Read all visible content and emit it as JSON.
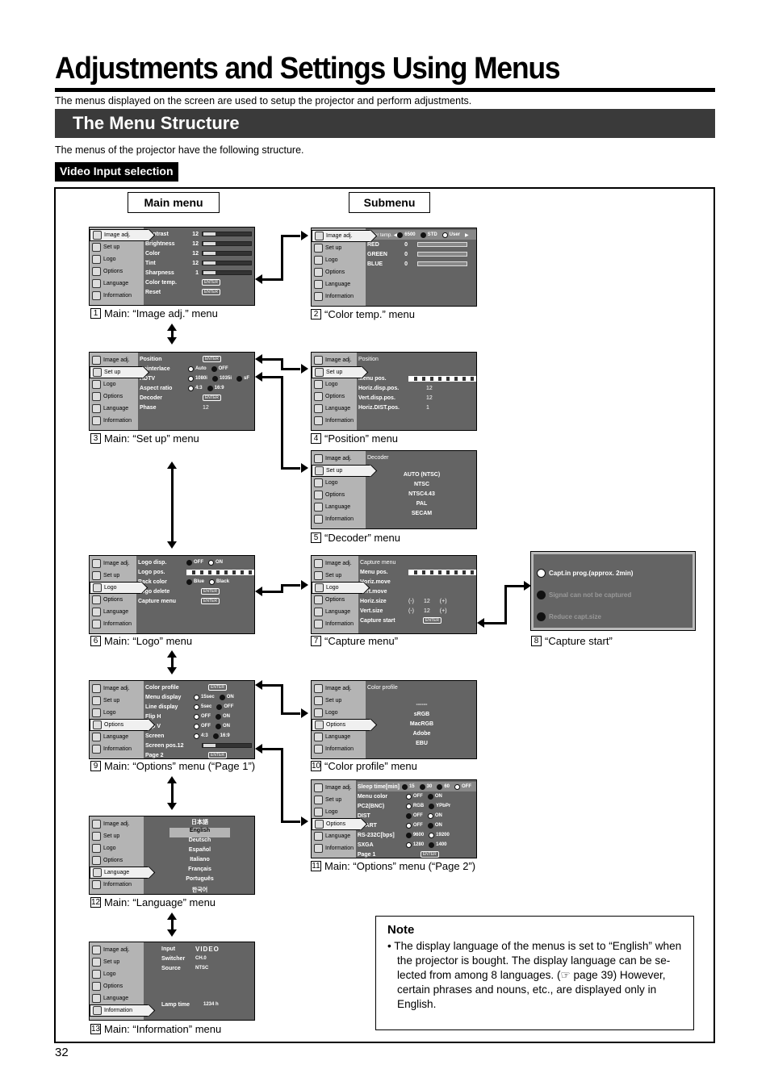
{
  "page": {
    "title": "Adjustments and Settings Using Menus",
    "intro": "The menus displayed on the screen are used to setup the projector and perform adjustments.",
    "section_title": "The Menu Structure",
    "section_intro": "The menus of the projector have the following structure.",
    "input_label": "Video Input selection",
    "main_menu_header": "Main menu",
    "submenu_header": "Submenu",
    "page_number": "32"
  },
  "sidebar": [
    "Image adj.",
    "Set up",
    "Logo",
    "Options",
    "Language",
    "Information"
  ],
  "enter": "ENTER",
  "menus": {
    "m1": {
      "num": "1",
      "caption": "Main: “Image adj.” menu",
      "rows": [
        {
          "label": "Contrast",
          "value": "12",
          "level": 0.25
        },
        {
          "label": "Brightness",
          "value": "12",
          "level": 0.25
        },
        {
          "label": "Color",
          "value": "12",
          "level": 0.25
        },
        {
          "label": "Tint",
          "value": "12",
          "level": 0.25
        },
        {
          "label": "Sharpness",
          "value": "1",
          "level": 0.25
        }
      ],
      "enter_rows": [
        "Color temp.",
        "Reset"
      ]
    },
    "m2": {
      "num": "2",
      "caption": "“Color temp.” menu",
      "header": "Color temp.",
      "options": [
        "6500",
        "STD",
        "User"
      ],
      "rows": [
        {
          "label": "RED",
          "value": "0"
        },
        {
          "label": "GREEN",
          "value": "0"
        },
        {
          "label": "BLUE",
          "value": "0"
        }
      ]
    },
    "m3": {
      "num": "3",
      "caption": "Main: “Set up” menu",
      "rows": [
        {
          "label": "Position",
          "enter": true
        },
        {
          "label": "Deinterlace",
          "opts": [
            "Auto",
            "OFF"
          ],
          "sel": 0
        },
        {
          "label": "HDTV",
          "opts": [
            "1080i",
            "1035i",
            "sF"
          ],
          "sel": 0
        },
        {
          "label": "Aspect ratio",
          "opts": [
            "4:3",
            "16:9"
          ],
          "sel": 0
        },
        {
          "label": "Decoder",
          "enter": true
        },
        {
          "label": "Phase",
          "text": "12"
        }
      ]
    },
    "m4": {
      "num": "4",
      "caption": "“Position” menu",
      "header": "Position",
      "rows": [
        {
          "label": "Menu pos."
        },
        {
          "label": "Horiz.disp.pos.",
          "value": "12"
        },
        {
          "label": "Vert.disp.pos.",
          "value": "12"
        },
        {
          "label": "Horiz.DIST.pos.",
          "value": "1"
        }
      ]
    },
    "m5": {
      "num": "5",
      "caption": "“Decoder” menu",
      "header": "Decoder",
      "items": [
        "AUTO      (NTSC)",
        "NTSC",
        "NTSC4.43",
        "PAL",
        "SECAM"
      ]
    },
    "m6": {
      "num": "6",
      "caption": "Main: “Logo” menu",
      "rows": [
        {
          "label": "Logo disp.",
          "opts": [
            "OFF",
            "ON"
          ],
          "sel": 1
        },
        {
          "label": "Logo pos."
        },
        {
          "label": "Back color",
          "opts": [
            "Blue",
            "Black"
          ],
          "sel": 1
        },
        {
          "label": "Logo delete",
          "enter": true
        },
        {
          "label": "Capture menu",
          "enter": true
        }
      ]
    },
    "m7": {
      "num": "7",
      "caption": "“Capture menu”",
      "header": "Capture menu",
      "rows": [
        {
          "label": "Menu pos."
        },
        {
          "label": "Horiz.move"
        },
        {
          "label": "Vert.move"
        },
        {
          "label": "Horiz.size",
          "minus": "(-)",
          "value": "12",
          "plus": "(+)"
        },
        {
          "label": "Vert.size",
          "minus": "(-)",
          "value": "12",
          "plus": "(+)"
        },
        {
          "label": "Capture start",
          "enter": true
        }
      ]
    },
    "m8": {
      "num": "8",
      "caption": "“Capture start”",
      "items": [
        "Capt.in prog.(approx. 2min)",
        "Signal can not be captured",
        "Reduce capt.size"
      ]
    },
    "m9": {
      "num": "9",
      "caption": "Main: “Options” menu (“Page 1”)",
      "rows": [
        {
          "label": "Color profile",
          "enter": true
        },
        {
          "label": "Menu display",
          "opts": [
            "15sec",
            "ON"
          ],
          "sel": 0
        },
        {
          "label": "Line display",
          "opts": [
            "5sec",
            "OFF"
          ],
          "sel": 0
        },
        {
          "label": "Flip H",
          "opts": [
            "OFF",
            "ON"
          ],
          "sel": 0
        },
        {
          "label": "Flip V",
          "opts": [
            "OFF",
            "ON"
          ],
          "sel": 0
        },
        {
          "label": "Screen",
          "opts": [
            "4:3",
            "16:9"
          ],
          "sel": 0
        },
        {
          "label": "Screen pos.12",
          "bar": 0.25
        },
        {
          "label": "Page 2",
          "enter": true
        }
      ]
    },
    "m10": {
      "num": "10",
      "caption": "“Color profile” menu",
      "header": "Color profile",
      "items": [
        "------",
        "sRGB",
        "MacRGB",
        "Adobe",
        "EBU"
      ]
    },
    "m11": {
      "num": "11",
      "caption": "Main: “Options” menu (“Page 2”)",
      "sleep_label": "Sleep time[min]",
      "sleep_opts": [
        "15",
        "30",
        "60",
        "OFF"
      ],
      "rows": [
        {
          "label": "Menu color",
          "opts": [
            "OFF",
            "ON"
          ],
          "sel": 0
        },
        {
          "label": "PC2(BNC)",
          "opts": [
            "RGB",
            "YPbPr"
          ],
          "sel": 0
        },
        {
          "label": "DIST",
          "opts": [
            "OFF",
            "ON"
          ],
          "sel": 1
        },
        {
          "label": "SCART",
          "opts": [
            "OFF",
            "ON"
          ],
          "sel": 0
        },
        {
          "label": "RS-232C[bps]",
          "opts": [
            "9600",
            "19200"
          ],
          "sel": 1
        },
        {
          "label": "SXGA",
          "opts": [
            "1280",
            "1400"
          ],
          "sel": 0
        },
        {
          "label": "Page 1",
          "enter": true
        }
      ]
    },
    "m12": {
      "num": "12",
      "caption": "Main: “Language” menu",
      "items": [
        "日本語",
        "English",
        "Deutsch",
        "Español",
        "Italiano",
        "Français",
        "Português",
        "한국어"
      ],
      "selected": 1
    },
    "m13": {
      "num": "13",
      "caption": "Main: “Information” menu",
      "rows": [
        {
          "label": "Input",
          "value": "VIDEO"
        },
        {
          "label": "Switcher",
          "value": "CH.0"
        },
        {
          "label": "Source",
          "value": "NTSC"
        }
      ],
      "lamp_label": "Lamp time",
      "lamp_value": "1234 h"
    }
  },
  "note": {
    "heading": "Note",
    "text": "• The display language of the menus is set to “English” when the projector is bought. The display language can be se-lected from among 8 languages. (☞ page 39) However, certain phrases and nouns, etc., are displayed only in English."
  }
}
